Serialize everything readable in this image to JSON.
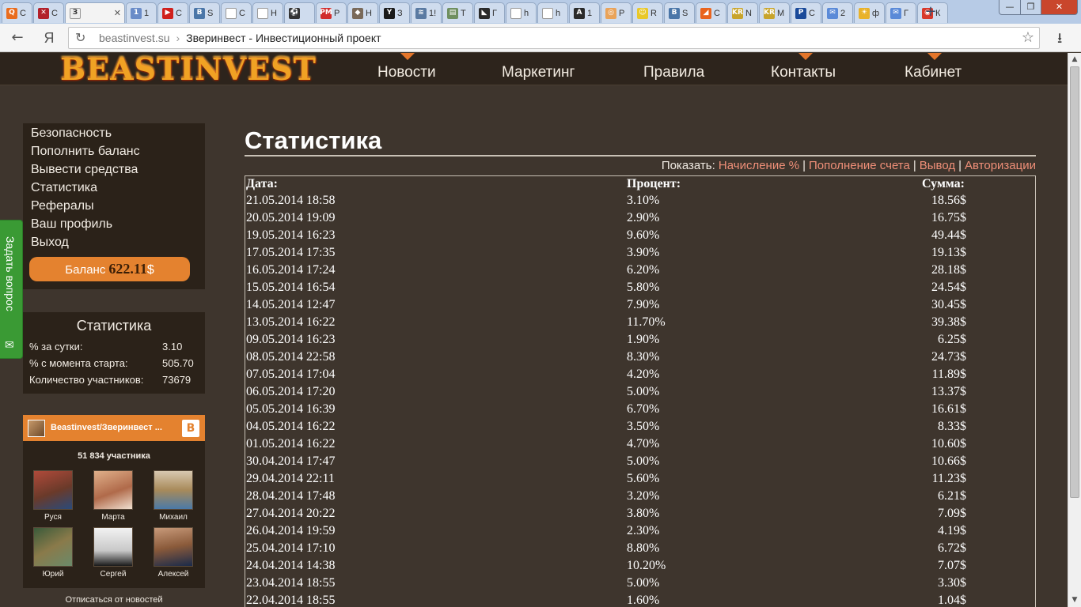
{
  "browser": {
    "tabs": [
      {
        "icon": "Q",
        "label": "С",
        "color": "#e96c1e"
      },
      {
        "icon": "✕",
        "label": "С",
        "color": "#b2202a"
      },
      {
        "icon": "З",
        "label": "",
        "color": "#eeeeee",
        "active": true
      },
      {
        "icon": "1",
        "label": "1",
        "color": "#6a8cc8"
      },
      {
        "icon": "▶",
        "label": "С",
        "color": "#d0201c"
      },
      {
        "icon": "В",
        "label": "S",
        "color": "#4a76a8"
      },
      {
        "icon": "",
        "label": "С",
        "color": "#ffffff"
      },
      {
        "icon": "",
        "label": "Н",
        "color": "#ffffff"
      },
      {
        "icon": "⚽",
        "label": "",
        "color": "#333333"
      },
      {
        "icon": "PM",
        "label": "Р",
        "color": "#d12c2c"
      },
      {
        "icon": "◆",
        "label": "Н",
        "color": "#7a6a5a"
      },
      {
        "icon": "Y",
        "label": "З",
        "color": "#1a1a1a"
      },
      {
        "icon": "≋",
        "label": "1!",
        "color": "#5a7aa2"
      },
      {
        "icon": "▤",
        "label": "Т",
        "color": "#6f8f5f"
      },
      {
        "icon": "◣",
        "label": "Г",
        "color": "#2a2a2a"
      },
      {
        "icon": "",
        "label": "h",
        "color": "#ffffff"
      },
      {
        "icon": "",
        "label": "h",
        "color": "#ffffff"
      },
      {
        "icon": "A",
        "label": "1",
        "color": "#2a2a2a"
      },
      {
        "icon": "◎",
        "label": "Р",
        "color": "#e9a35a"
      },
      {
        "icon": "☺",
        "label": "R",
        "color": "#e9c82a"
      },
      {
        "icon": "В",
        "label": "S",
        "color": "#4a76a8"
      },
      {
        "icon": "◢",
        "label": "С",
        "color": "#e9641e"
      },
      {
        "icon": "KR",
        "label": "N",
        "color": "#c8a42a"
      },
      {
        "icon": "KR",
        "label": "M",
        "color": "#c8a42a"
      },
      {
        "icon": "P",
        "label": "С",
        "color": "#1a4a9a"
      },
      {
        "icon": "✉",
        "label": "2",
        "color": "#5a8ad8"
      },
      {
        "icon": "☀",
        "label": "ф",
        "color": "#e9b22a"
      },
      {
        "icon": "✉",
        "label": "Г",
        "color": "#5a8ad8"
      },
      {
        "icon": "◉",
        "label": "К",
        "color": "#d8382a"
      }
    ],
    "new_tab": "+",
    "window_controls": {
      "minimize": "—",
      "maximize": "❐",
      "close": "✕"
    },
    "back": "←",
    "yandex": "Я",
    "reload": "↻",
    "url": "beastinvest.su",
    "url_separator": "›",
    "page_title": "Зверинвест - Инвестиционный проект",
    "bookmark": "☆",
    "download": "⭳"
  },
  "site": {
    "logo": "BEASTINVEST",
    "nav": [
      {
        "label": "Новости",
        "marker": true
      },
      {
        "label": "Маркетинг",
        "marker": false
      },
      {
        "label": "Правила",
        "marker": false
      },
      {
        "label": "Контакты",
        "marker": true
      },
      {
        "label": "Кабинет",
        "marker": true
      }
    ]
  },
  "sidebar": {
    "menu": [
      "Безопасность",
      "Пополнить баланс",
      "Вывести средства",
      "Статистика",
      "Рефералы",
      "Ваш профиль",
      "Выход"
    ],
    "balance_label": "Баланс",
    "balance_value": "622.11",
    "balance_currency": "$"
  },
  "stats": {
    "title": "Статистика",
    "rows": [
      {
        "label": "% за сутки:",
        "value": "3.10"
      },
      {
        "label": "% с момента старта:",
        "value": "505.70"
      },
      {
        "label": "Количество участников:",
        "value": "73679"
      }
    ]
  },
  "vk": {
    "group_name": "Beastinvest/Зверинвест ...",
    "logo": "В",
    "members_count": "51 834 участника",
    "members": [
      "Руся",
      "Марта",
      "Михаил",
      "Юрий",
      "Сергей",
      "Алексей"
    ],
    "unsubscribe": "Отписаться от новостей"
  },
  "ask": {
    "label": "Задать вопрос",
    "icon": "✉"
  },
  "content": {
    "title": "Статистика",
    "show_label": "Показать:",
    "filters": [
      "Начисление %",
      "Пополнение счета",
      "Вывод",
      "Авторизации"
    ],
    "filter_separator": "|",
    "columns": {
      "date": "Дата:",
      "percent": "Процент:",
      "sum": "Сумма:"
    },
    "rows": [
      {
        "date": "21.05.2014 18:58",
        "percent": "3.10%",
        "sum": "18.56$"
      },
      {
        "date": "20.05.2014 19:09",
        "percent": "2.90%",
        "sum": "16.75$"
      },
      {
        "date": "19.05.2014 16:23",
        "percent": "9.60%",
        "sum": "49.44$"
      },
      {
        "date": "17.05.2014 17:35",
        "percent": "3.90%",
        "sum": "19.13$"
      },
      {
        "date": "16.05.2014 17:24",
        "percent": "6.20%",
        "sum": "28.18$"
      },
      {
        "date": "15.05.2014 16:54",
        "percent": "5.80%",
        "sum": "24.54$"
      },
      {
        "date": "14.05.2014 12:47",
        "percent": "7.90%",
        "sum": "30.45$"
      },
      {
        "date": "13.05.2014 16:22",
        "percent": "11.70%",
        "sum": "39.38$"
      },
      {
        "date": "09.05.2014 16:23",
        "percent": "1.90%",
        "sum": "6.25$"
      },
      {
        "date": "08.05.2014 22:58",
        "percent": "8.30%",
        "sum": "24.73$"
      },
      {
        "date": "07.05.2014 17:04",
        "percent": "4.20%",
        "sum": "11.89$"
      },
      {
        "date": "06.05.2014 17:20",
        "percent": "5.00%",
        "sum": "13.37$"
      },
      {
        "date": "05.05.2014 16:39",
        "percent": "6.70%",
        "sum": "16.61$"
      },
      {
        "date": "04.05.2014 16:22",
        "percent": "3.50%",
        "sum": "8.33$"
      },
      {
        "date": "01.05.2014 16:22",
        "percent": "4.70%",
        "sum": "10.60$"
      },
      {
        "date": "30.04.2014 17:47",
        "percent": "5.00%",
        "sum": "10.66$"
      },
      {
        "date": "29.04.2014 22:11",
        "percent": "5.60%",
        "sum": "11.23$"
      },
      {
        "date": "28.04.2014 17:48",
        "percent": "3.20%",
        "sum": "6.21$"
      },
      {
        "date": "27.04.2014 20:22",
        "percent": "3.80%",
        "sum": "7.09$"
      },
      {
        "date": "26.04.2014 19:59",
        "percent": "2.30%",
        "sum": "4.19$"
      },
      {
        "date": "25.04.2014 17:10",
        "percent": "8.80%",
        "sum": "6.72$"
      },
      {
        "date": "24.04.2014 14:38",
        "percent": "10.20%",
        "sum": "7.07$"
      },
      {
        "date": "23.04.2014 18:55",
        "percent": "5.00%",
        "sum": "3.30$"
      },
      {
        "date": "22.04.2014 18:55",
        "percent": "1.60%",
        "sum": "1.04$"
      }
    ]
  }
}
